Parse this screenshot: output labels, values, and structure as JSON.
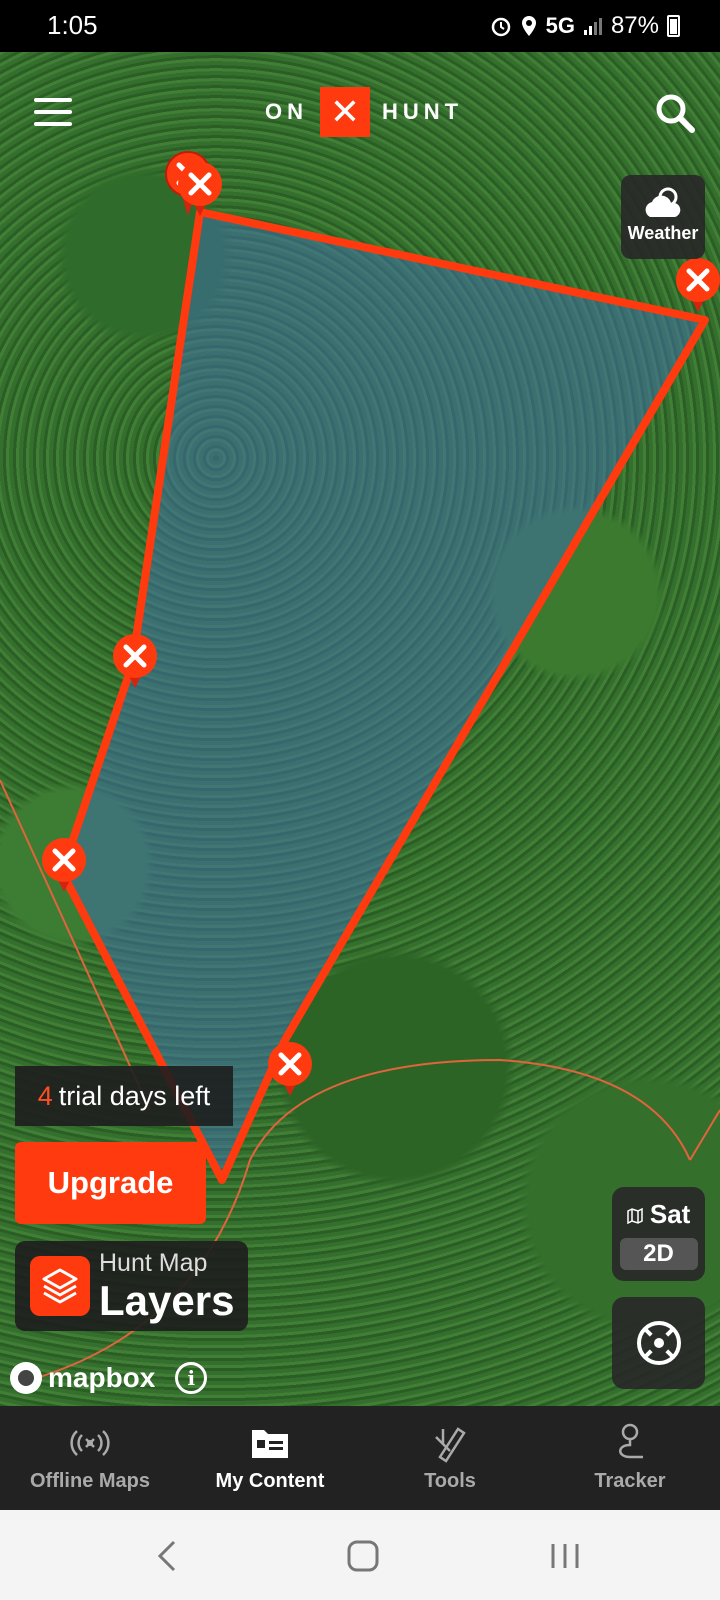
{
  "status_bar": {
    "time": "1:05",
    "network": "5G",
    "battery": "87%"
  },
  "header": {
    "logo_left": "ON",
    "logo_mark": "✕",
    "logo_right": "HUNT"
  },
  "weather": {
    "label": "Weather"
  },
  "trial": {
    "days": "4",
    "text": "trial days left"
  },
  "upgrade": {
    "label": "Upgrade"
  },
  "layers": {
    "subtitle": "Hunt Map",
    "title": "Layers"
  },
  "attribution": {
    "text": "mapbox",
    "info": "i"
  },
  "basemap": {
    "type": "Sat",
    "mode": "2D"
  },
  "bottom_nav": {
    "items": [
      {
        "label": "Offline Maps",
        "icon": "offline-icon",
        "active": false
      },
      {
        "label": "My Content",
        "icon": "folder-icon",
        "active": true
      },
      {
        "label": "Tools",
        "icon": "tools-icon",
        "active": false
      },
      {
        "label": "Tracker",
        "icon": "tracker-icon",
        "active": false
      }
    ]
  },
  "colors": {
    "accent": "#ff3a0f",
    "polygon_fill": "#3f6fa8",
    "nav_bg": "#222222"
  }
}
